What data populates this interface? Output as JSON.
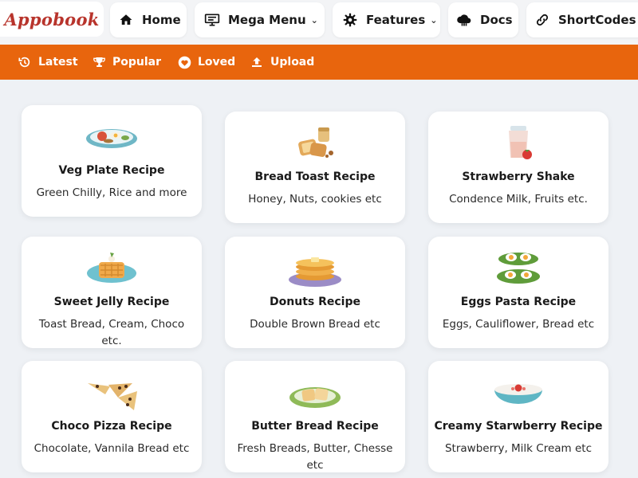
{
  "brand": {
    "logo_text": "Appobook"
  },
  "nav": {
    "home": "Home",
    "mega_menu": "Mega Menu",
    "features": "Features",
    "docs": "Docs",
    "shortcodes": "ShortCodes"
  },
  "subnav": {
    "latest": "Latest",
    "popular": "Popular",
    "loved": "Loved",
    "upload": "Upload"
  },
  "colors": {
    "accent": "#e8650d",
    "brand": "#b8342c"
  },
  "recipes": [
    {
      "title": "Veg Plate Recipe",
      "desc": "Green Chilly, Rice and more",
      "icon": "veg-plate-icon"
    },
    {
      "title": "Bread Toast Recipe",
      "desc": "Honey, Nuts, cookies etc",
      "icon": "bread-toast-icon"
    },
    {
      "title": "Strawberry Shake",
      "desc": "Condence Milk, Fruits etc.",
      "icon": "strawberry-shake-icon"
    },
    {
      "title": "Sweet Jelly Recipe",
      "desc": "Toast Bread, Cream, Choco etc.",
      "icon": "sweet-jelly-icon"
    },
    {
      "title": "Donuts Recipe",
      "desc": "Double Brown Bread etc",
      "icon": "pancakes-icon"
    },
    {
      "title": "Eggs Pasta Recipe",
      "desc": "Eggs, Cauliflower, Bread etc",
      "icon": "eggs-icon"
    },
    {
      "title": "Choco Pizza Recipe",
      "desc": "Chocolate, Vannila Bread etc",
      "icon": "choco-pizza-icon"
    },
    {
      "title": "Butter Bread Recipe",
      "desc": "Fresh Breads, Butter, Chesse etc",
      "icon": "butter-bread-icon"
    },
    {
      "title": "Creamy Starwberry Recipe",
      "desc": "Strawberry, Milk Cream etc",
      "icon": "strawberry-bowl-icon"
    }
  ]
}
